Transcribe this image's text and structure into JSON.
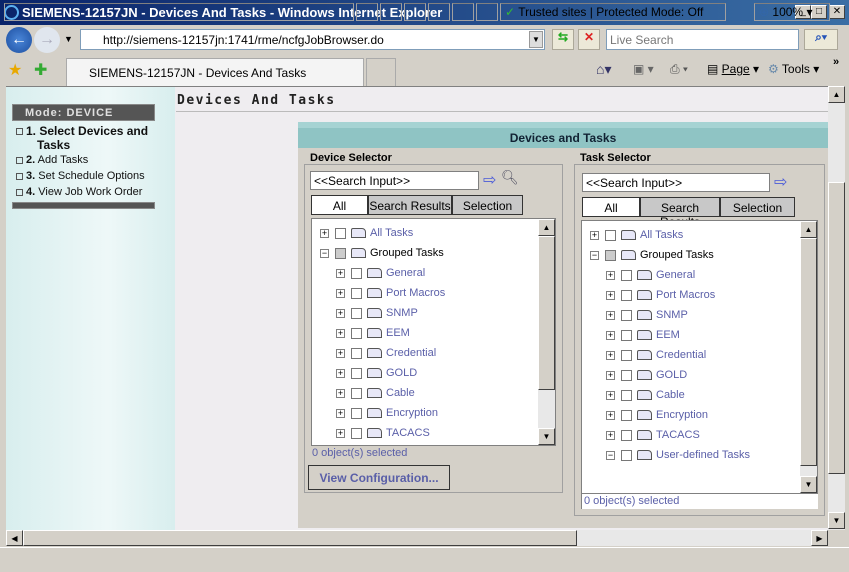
{
  "window": {
    "title": "SIEMENS-12157JN - Devices And Tasks - Windows Internet Explorer"
  },
  "browser": {
    "url": "http://siemens-12157jn:1741/rme/ncfgJobBrowser.do",
    "search_placeholder": "Live Search",
    "tab_title": "SIEMENS-12157JN - Devices And Tasks",
    "page_menu": "Page",
    "tools_menu": "Tools",
    "chevron": "»"
  },
  "sidebar": {
    "mode": "Mode: DEVICE",
    "steps": [
      {
        "num": "1.",
        "label": "Select Devices and",
        "label2": "Tasks"
      },
      {
        "num": "2.",
        "label": "Add Tasks"
      },
      {
        "num": "3.",
        "label": "Set Schedule Options"
      },
      {
        "num": "4.",
        "label": "View Job Work Order"
      }
    ]
  },
  "page": {
    "title": "Devices And Tasks",
    "panel_title": "Devices and Tasks"
  },
  "device_selector": {
    "legend": "Device Selector",
    "search_value": "<<Search Input>>",
    "tabs": [
      "All",
      "Search Results",
      "Selection"
    ],
    "active_tab": "All",
    "tree": [
      {
        "label": "All Tasks",
        "lvl": 0,
        "exp": "+"
      },
      {
        "label": "Grouped Tasks",
        "lvl": 0,
        "exp": "-"
      },
      {
        "label": "General",
        "lvl": 1,
        "exp": "+"
      },
      {
        "label": "Port Macros",
        "lvl": 1,
        "exp": "+"
      },
      {
        "label": "SNMP",
        "lvl": 1,
        "exp": "+"
      },
      {
        "label": "EEM",
        "lvl": 1,
        "exp": "+"
      },
      {
        "label": "Credential",
        "lvl": 1,
        "exp": "+"
      },
      {
        "label": "GOLD",
        "lvl": 1,
        "exp": "+"
      },
      {
        "label": "Cable",
        "lvl": 1,
        "exp": "+"
      },
      {
        "label": "Encryption",
        "lvl": 1,
        "exp": "+"
      },
      {
        "label": "TACACS",
        "lvl": 1,
        "exp": "+"
      }
    ],
    "status": "0 object(s) selected",
    "view_button": "View Configuration..."
  },
  "task_selector": {
    "legend": "Task Selector",
    "search_value": "<<Search Input>>",
    "tabs": [
      "All",
      "Search Results",
      "Selection"
    ],
    "active_tab": "All",
    "tree": [
      {
        "label": "All Tasks",
        "lvl": 0,
        "exp": "+"
      },
      {
        "label": "Grouped Tasks",
        "lvl": 0,
        "exp": "-"
      },
      {
        "label": "General",
        "lvl": 1,
        "exp": "+"
      },
      {
        "label": "Port Macros",
        "lvl": 1,
        "exp": "+"
      },
      {
        "label": "SNMP",
        "lvl": 1,
        "exp": "+"
      },
      {
        "label": "EEM",
        "lvl": 1,
        "exp": "+"
      },
      {
        "label": "Credential",
        "lvl": 1,
        "exp": "+"
      },
      {
        "label": "GOLD",
        "lvl": 1,
        "exp": "+"
      },
      {
        "label": "Cable",
        "lvl": 1,
        "exp": "+"
      },
      {
        "label": "Encryption",
        "lvl": 1,
        "exp": "+"
      },
      {
        "label": "TACACS",
        "lvl": 1,
        "exp": "+"
      },
      {
        "label": "User-defined Tasks",
        "lvl": 1,
        "exp": "-"
      }
    ],
    "status": "0 object(s) selected"
  },
  "statusbar": {
    "zone": "Trusted sites | Protected Mode: Off",
    "zoom": "100%"
  }
}
